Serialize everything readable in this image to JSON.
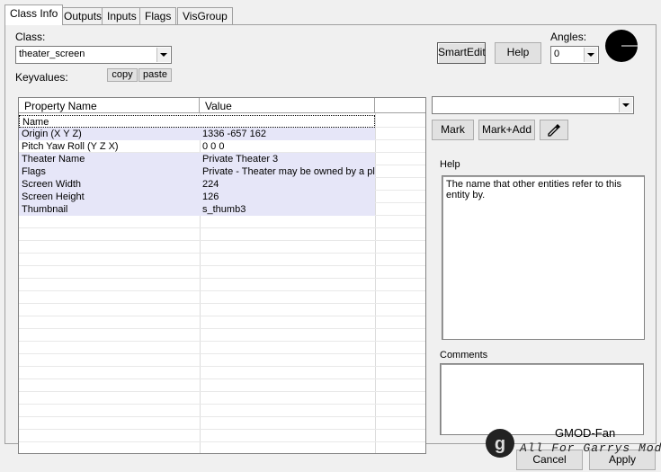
{
  "tabs": [
    {
      "label": "Class Info",
      "active": true
    },
    {
      "label": "Outputs",
      "active": false
    },
    {
      "label": "Inputs",
      "active": false
    },
    {
      "label": "Flags",
      "active": false
    },
    {
      "label": "VisGroup",
      "active": false
    }
  ],
  "class_section": {
    "class_label": "Class:",
    "class_value": "theater_screen",
    "keyvalues_label": "Keyvalues:",
    "copy_label": "copy",
    "paste_label": "paste"
  },
  "toolbar": {
    "smartedit_label": "SmartEdit",
    "help_label": "Help",
    "angles_label": "Angles:",
    "angles_value": "0"
  },
  "table": {
    "columns": [
      "Property Name",
      "Value"
    ],
    "rows": [
      {
        "name": "Name",
        "value": ""
      },
      {
        "name": "Origin (X Y Z)",
        "value": "1336 -657 162"
      },
      {
        "name": "Pitch Yaw Roll (Y Z X)",
        "value": "0 0 0"
      },
      {
        "name": "Theater Name",
        "value": "Private Theater 3"
      },
      {
        "name": "Flags",
        "value": "Private - Theater may be owned by a play"
      },
      {
        "name": "Screen Width",
        "value": "224"
      },
      {
        "name": "Screen Height",
        "value": "126"
      },
      {
        "name": "Thumbnail",
        "value": "s_thumb3"
      }
    ]
  },
  "right_panel": {
    "mark_label": "Mark",
    "mark_add_label": "Mark+Add",
    "help_heading": "Help",
    "help_text": "The name that other entities refer to this entity by.",
    "comments_heading": "Comments"
  },
  "watermark": {
    "title": "GMOD-Fan",
    "subtitle": "All For Garrys Mod"
  },
  "bottom_buttons": {
    "cancel_label": "Cancel",
    "apply_label": "Apply"
  }
}
